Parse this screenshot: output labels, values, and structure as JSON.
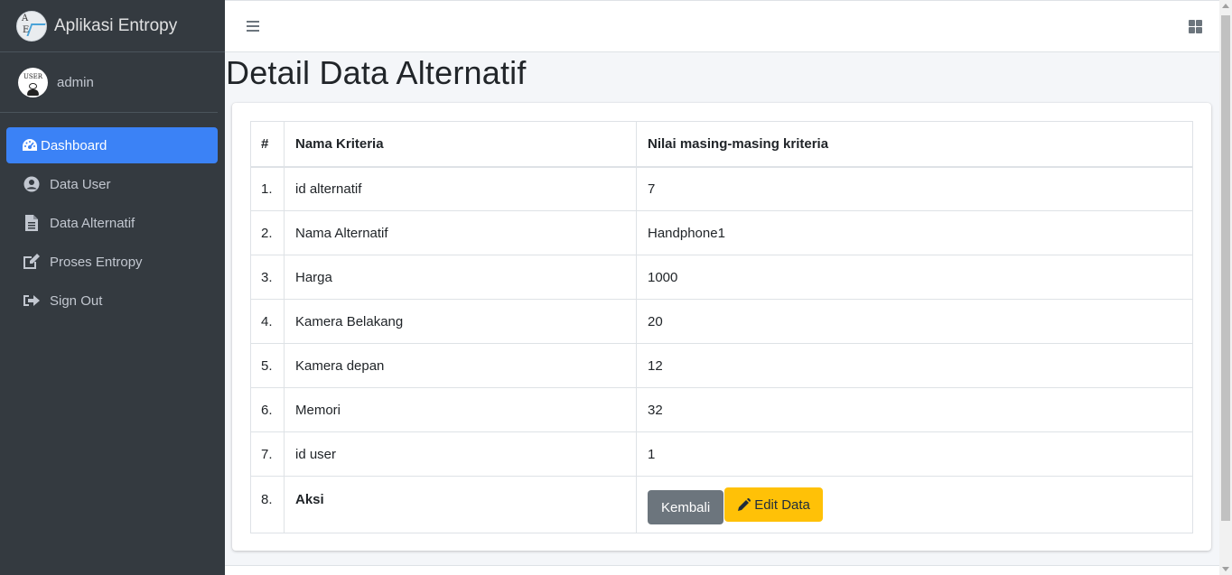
{
  "brand": {
    "title": "Aplikasi Entropy",
    "logo_letters": [
      "A",
      "E"
    ]
  },
  "user": {
    "name": "admin",
    "avatar_text": "USER"
  },
  "sidebar": {
    "items": [
      {
        "label": "Dashboard",
        "icon": "tachometer-icon",
        "active": true
      },
      {
        "label": "Data User",
        "icon": "user-circle-icon"
      },
      {
        "label": "Data Alternatif",
        "icon": "file-icon"
      },
      {
        "label": "Proses Entropy",
        "icon": "edit-icon"
      },
      {
        "label": "Sign Out",
        "icon": "sign-out-icon"
      }
    ]
  },
  "navbar": {
    "menu_icon": "hamburger-icon",
    "apps_icon": "grid-icon"
  },
  "page": {
    "title": "Detail Data Alternatif"
  },
  "table": {
    "headers": [
      "#",
      "Nama Kriteria",
      "Nilai masing-masing kriteria"
    ],
    "rows": [
      {
        "no": "1.",
        "kriteria": "id alternatif",
        "nilai": "7"
      },
      {
        "no": "2.",
        "kriteria": "Nama Alternatif",
        "nilai": "Handphone1"
      },
      {
        "no": "3.",
        "kriteria": "Harga",
        "nilai": "1000"
      },
      {
        "no": "4.",
        "kriteria": "Kamera Belakang",
        "nilai": "20"
      },
      {
        "no": "5.",
        "kriteria": "Kamera depan",
        "nilai": "12"
      },
      {
        "no": "6.",
        "kriteria": "Memori",
        "nilai": "32"
      },
      {
        "no": "7.",
        "kriteria": "id user",
        "nilai": "1"
      }
    ],
    "aksi": {
      "no": "8.",
      "label": "Aksi",
      "back_button": "Kembali",
      "edit_button": "Edit Data"
    }
  },
  "colors": {
    "sidebar_bg": "#343a40",
    "active_blue": "#3b82f6",
    "btn_secondary": "#6c757d",
    "btn_warning": "#ffc107"
  }
}
